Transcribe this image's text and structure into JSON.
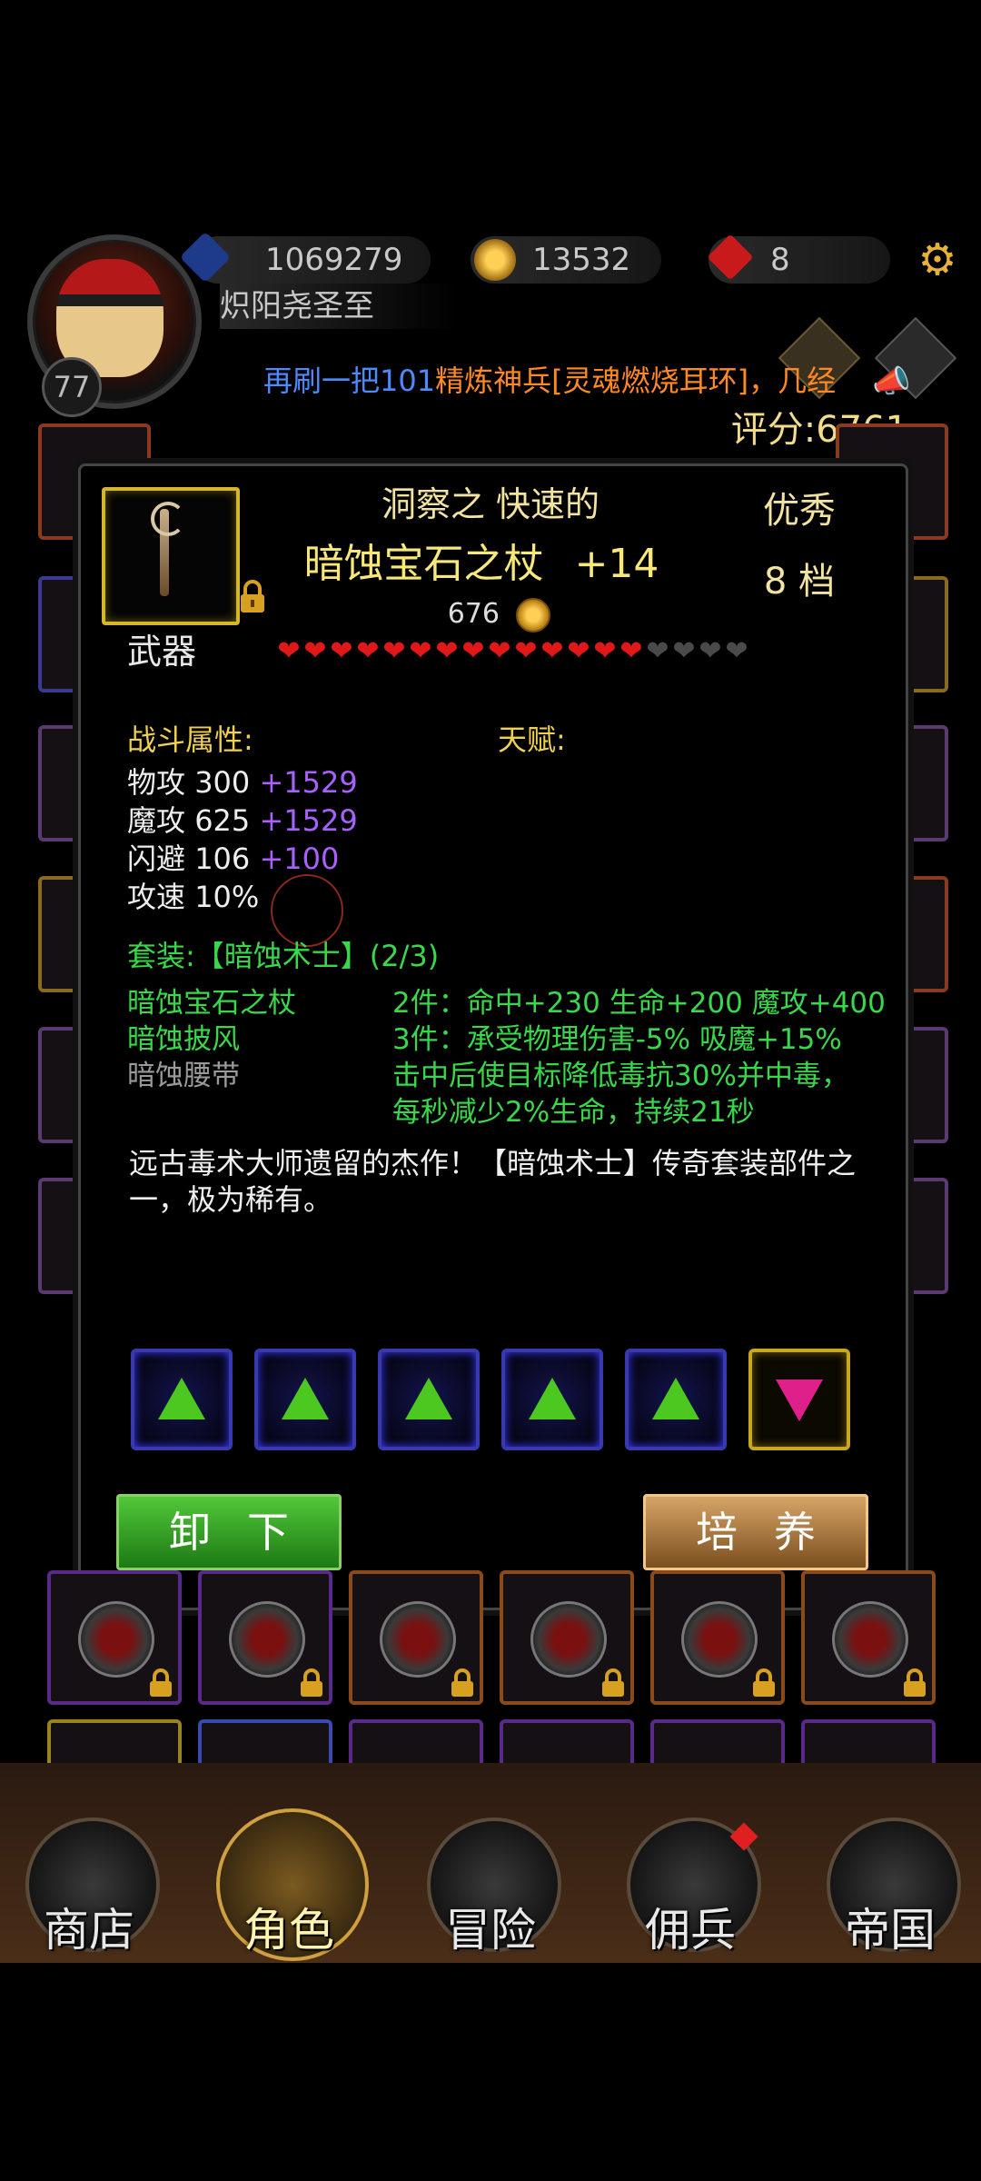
{
  "header": {
    "level": "77",
    "player_name": "炽阳尧圣至",
    "resources": [
      {
        "icon": "blue-crystal-icon",
        "value": "1069279"
      },
      {
        "icon": "gold-coin-icon",
        "value": "13532"
      },
      {
        "icon": "red-gem-icon",
        "value": "8"
      }
    ],
    "settings_icon": "gear-icon",
    "marquee": {
      "part1": "再刷一把",
      "part2": "101",
      "part3": "精炼神兵[灵魂燃烧耳环]，几经"
    },
    "score": "评分:6761"
  },
  "item": {
    "prefix": "洞察之  快速的",
    "name": "暗蚀宝石之杖",
    "enhance": "+14",
    "price": "676",
    "quality": "优秀",
    "grade": "8 档",
    "type": "武器",
    "stars_filled": 14,
    "stars_total": 18
  },
  "attributes": {
    "combat_label": "战斗属性:",
    "talent_label": "天赋:",
    "stats": [
      {
        "name": "物攻",
        "base": "300",
        "bonus": "+1529"
      },
      {
        "name": "魔攻",
        "base": "625",
        "bonus": "+1529"
      },
      {
        "name": "闪避",
        "base": "106",
        "bonus": "+100"
      },
      {
        "name": "攻速",
        "base": "10%",
        "bonus": ""
      }
    ]
  },
  "set": {
    "title": "套装:【暗蚀术士】(2/3)",
    "pieces": [
      {
        "name": "暗蚀宝石之杖",
        "owned": true
      },
      {
        "name": "暗蚀披风",
        "owned": true
      },
      {
        "name": "暗蚀腰带",
        "owned": false
      }
    ],
    "bonuses": [
      "2件：命中+230 生命+200 魔攻+400",
      "3件：承受物理伤害-5% 吸魔+15%",
      "击中后使目标降低毒抗30%并中毒，",
      "每秒减少2%生命，持续21秒"
    ]
  },
  "description": "远古毒术大师遗留的杰作！【暗蚀术士】传奇套装部件之一，极为稀有。",
  "gems": [
    "green-gem",
    "green-gem",
    "green-gem",
    "green-gem",
    "green-gem",
    "pink-gem"
  ],
  "buttons": {
    "unequip": "卸下",
    "train": "培养"
  },
  "nav": [
    {
      "label": "商店",
      "icon": "shop-icon"
    },
    {
      "label": "角色",
      "icon": "hooded-hero-icon"
    },
    {
      "label": "冒险",
      "icon": "crossed-swords-icon"
    },
    {
      "label": "佣兵",
      "icon": "mercenary-cards-icon"
    },
    {
      "label": "帝国",
      "icon": "crown-icon"
    }
  ],
  "colors": {
    "title_gold": "#f8e87a",
    "bonus_purple": "#a860ff",
    "set_green": "#38d84a",
    "heart_red": "#e01818"
  }
}
